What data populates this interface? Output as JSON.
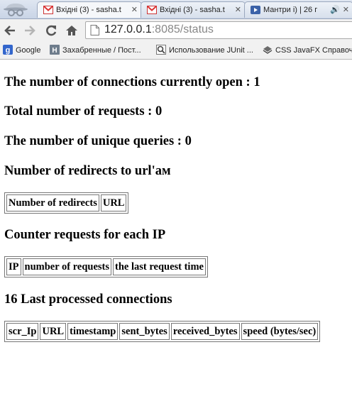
{
  "browser": {
    "tabs": [
      {
        "title": "Вхідні (3) - sasha.t",
        "icon": "gmail-icon"
      },
      {
        "title": "Вхідні (3) - sasha.t",
        "icon": "gmail-icon"
      },
      {
        "title": "Мантри і) | 26 г",
        "icon": "play-icon"
      }
    ],
    "address": {
      "host": "127.0.0.1",
      "port": ":8085",
      "path": "/status"
    },
    "bookmarks": [
      {
        "label": "Google",
        "icon": "google-icon"
      },
      {
        "label": "Захабренные / Пост...",
        "icon": "habr-icon"
      },
      {
        "label": "Использование JUnit ...",
        "icon": "search-icon"
      },
      {
        "label": "CSS JavaFX Справоч...",
        "icon": "book-icon"
      }
    ]
  },
  "status": {
    "open_connections": "The number of connections currently open : 1",
    "total_requests": "Total number of requests : 0",
    "unique_queries": "The number of unique queries : 0",
    "redirects_title": "Number of redirects to url'ам",
    "redirects_headers": [
      "Number of redirects",
      "URL"
    ],
    "ip_title": "Counter requests for each IP",
    "ip_headers": [
      "IP",
      "number of requests",
      "the last request time"
    ],
    "connections_title": "16 Last processed connections",
    "connections_headers": [
      "scr_Ip",
      "URL",
      "timestamp",
      "sent_bytes",
      "received_bytes",
      "speed (bytes/sec)"
    ]
  }
}
